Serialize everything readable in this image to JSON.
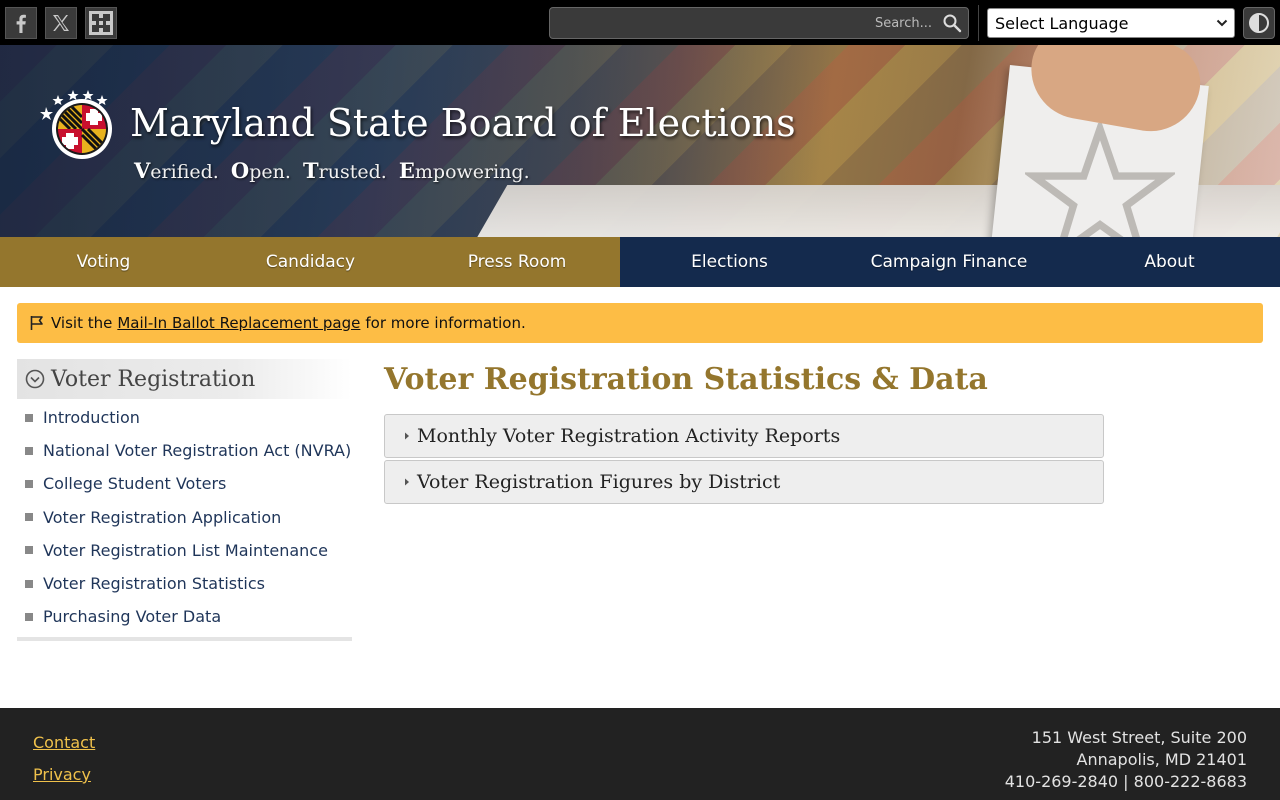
{
  "topbar": {
    "social": [
      {
        "name": "facebook",
        "icon": "facebook-icon"
      },
      {
        "name": "x",
        "icon": "x-icon"
      },
      {
        "name": "flickr",
        "icon": "flickr-icon"
      }
    ],
    "search": {
      "placeholder": "Search...",
      "value": ""
    },
    "language": {
      "selected": "Select Language"
    },
    "contrast_icon": "contrast-icon"
  },
  "banner": {
    "title": "Maryland State Board of Elections",
    "tagline": [
      {
        "initial": "V",
        "rest": "erified."
      },
      {
        "initial": "O",
        "rest": "pen."
      },
      {
        "initial": "T",
        "rest": "rusted."
      },
      {
        "initial": "E",
        "rest": "mpowering."
      }
    ]
  },
  "nav": {
    "items": [
      {
        "label": "Voting",
        "style": "gold"
      },
      {
        "label": "Candidacy",
        "style": "gold"
      },
      {
        "label": "Press Room",
        "style": "gold"
      },
      {
        "label": "Elections",
        "style": "blue"
      },
      {
        "label": "Campaign Finance",
        "style": "blue"
      },
      {
        "label": "About",
        "style": "blue"
      }
    ]
  },
  "alert": {
    "prefix": "Visit the",
    "link": "Mail-In Ballot Replacement page",
    "suffix": "for more information."
  },
  "sidebar": {
    "heading": "Voter Registration",
    "items": [
      "Introduction",
      "National Voter Registration Act (NVRA)",
      "College Student Voters",
      "Voter Registration Application",
      "Voter Registration List Maintenance",
      "Voter Registration Statistics",
      "Purchasing Voter Data"
    ]
  },
  "main": {
    "title": "Voter Registration Statistics & Data",
    "accordions": [
      "Monthly Voter Registration Activity Reports",
      "Voter Registration Figures by District"
    ]
  },
  "footer": {
    "links": [
      "Contact",
      "Privacy"
    ],
    "address": [
      "151 West Street, Suite 200",
      "Annapolis, MD 21401",
      "410-269-2840 | 800-222-8683"
    ]
  },
  "colors": {
    "gold": "#94762d",
    "navy": "#142a4d",
    "alert": "#fdbd45",
    "footer": "#222222",
    "footer_link": "#f0c14b"
  }
}
